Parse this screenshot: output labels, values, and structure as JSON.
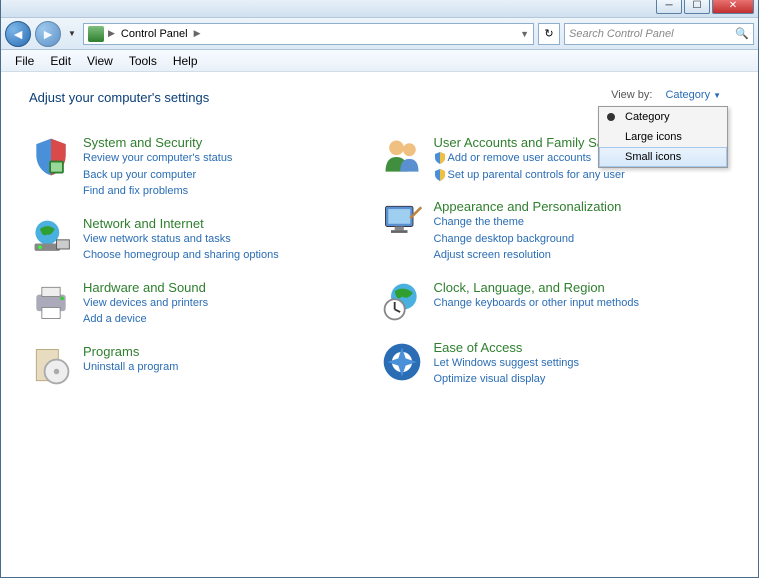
{
  "window": {
    "min_tip": "Minimize",
    "max_tip": "Maximize",
    "close_tip": "Close"
  },
  "nav": {
    "back_tip": "Back",
    "fwd_tip": "Forward",
    "crumb1": "Control Panel",
    "refresh_tip": "Refresh",
    "search_placeholder": "Search Control Panel"
  },
  "menu": {
    "file": "File",
    "edit": "Edit",
    "view": "View",
    "tools": "Tools",
    "help": "Help"
  },
  "content": {
    "heading": "Adjust your computer's settings",
    "viewby_label": "View by:",
    "viewby_value": "Category"
  },
  "popup": {
    "category": "Category",
    "large": "Large icons",
    "small": "Small icons"
  },
  "cats": {
    "system": {
      "title": "System and Security",
      "l1": "Review your computer's status",
      "l2": "Back up your computer",
      "l3": "Find and fix problems"
    },
    "network": {
      "title": "Network and Internet",
      "l1": "View network status and tasks",
      "l2": "Choose homegroup and sharing options"
    },
    "hardware": {
      "title": "Hardware and Sound",
      "l1": "View devices and printers",
      "l2": "Add a device"
    },
    "programs": {
      "title": "Programs",
      "l1": "Uninstall a program"
    },
    "users": {
      "title": "User Accounts and Family Safety",
      "l1": "Add or remove user accounts",
      "l2": "Set up parental controls for any user"
    },
    "appearance": {
      "title": "Appearance and Personalization",
      "l1": "Change the theme",
      "l2": "Change desktop background",
      "l3": "Adjust screen resolution"
    },
    "clock": {
      "title": "Clock, Language, and Region",
      "l1": "Change keyboards or other input methods"
    },
    "ease": {
      "title": "Ease of Access",
      "l1": "Let Windows suggest settings",
      "l2": "Optimize visual display"
    }
  }
}
